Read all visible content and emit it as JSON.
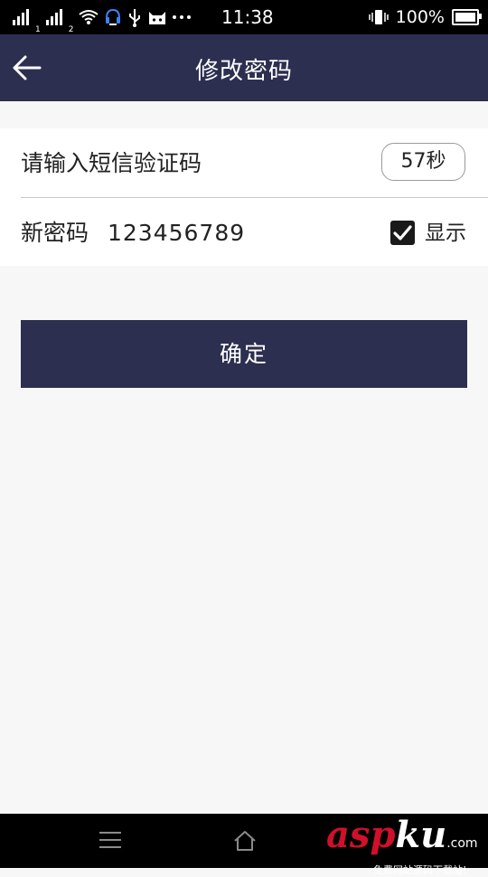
{
  "status_bar": {
    "time": "11:38",
    "battery": "100%",
    "battery_level": 1.0,
    "sim1_label": "1",
    "sim2_label": "2"
  },
  "header": {
    "title": "修改密码",
    "back_icon": "arrow-left-icon"
  },
  "form": {
    "sms_code_placeholder": "请输入短信验证码",
    "countdown_label": "57秒",
    "new_password_label": "新密码",
    "new_password_value": "123456789",
    "show_password_checked": true,
    "show_password_label": "显示"
  },
  "confirm_button_label": "确定",
  "nav_bar": {
    "menu_icon": "menu-icon",
    "home_icon": "home-icon"
  },
  "watermark": {
    "main_red": "asp",
    "main_white": "ku",
    "domain": ".com",
    "tagline": "免费网站源码下载站!"
  },
  "colors": {
    "header_bg": "#2c2f4f",
    "button_bg": "#2c2f4f",
    "page_bg": "#f7f7f7",
    "watermark_red": "#d0102a"
  }
}
